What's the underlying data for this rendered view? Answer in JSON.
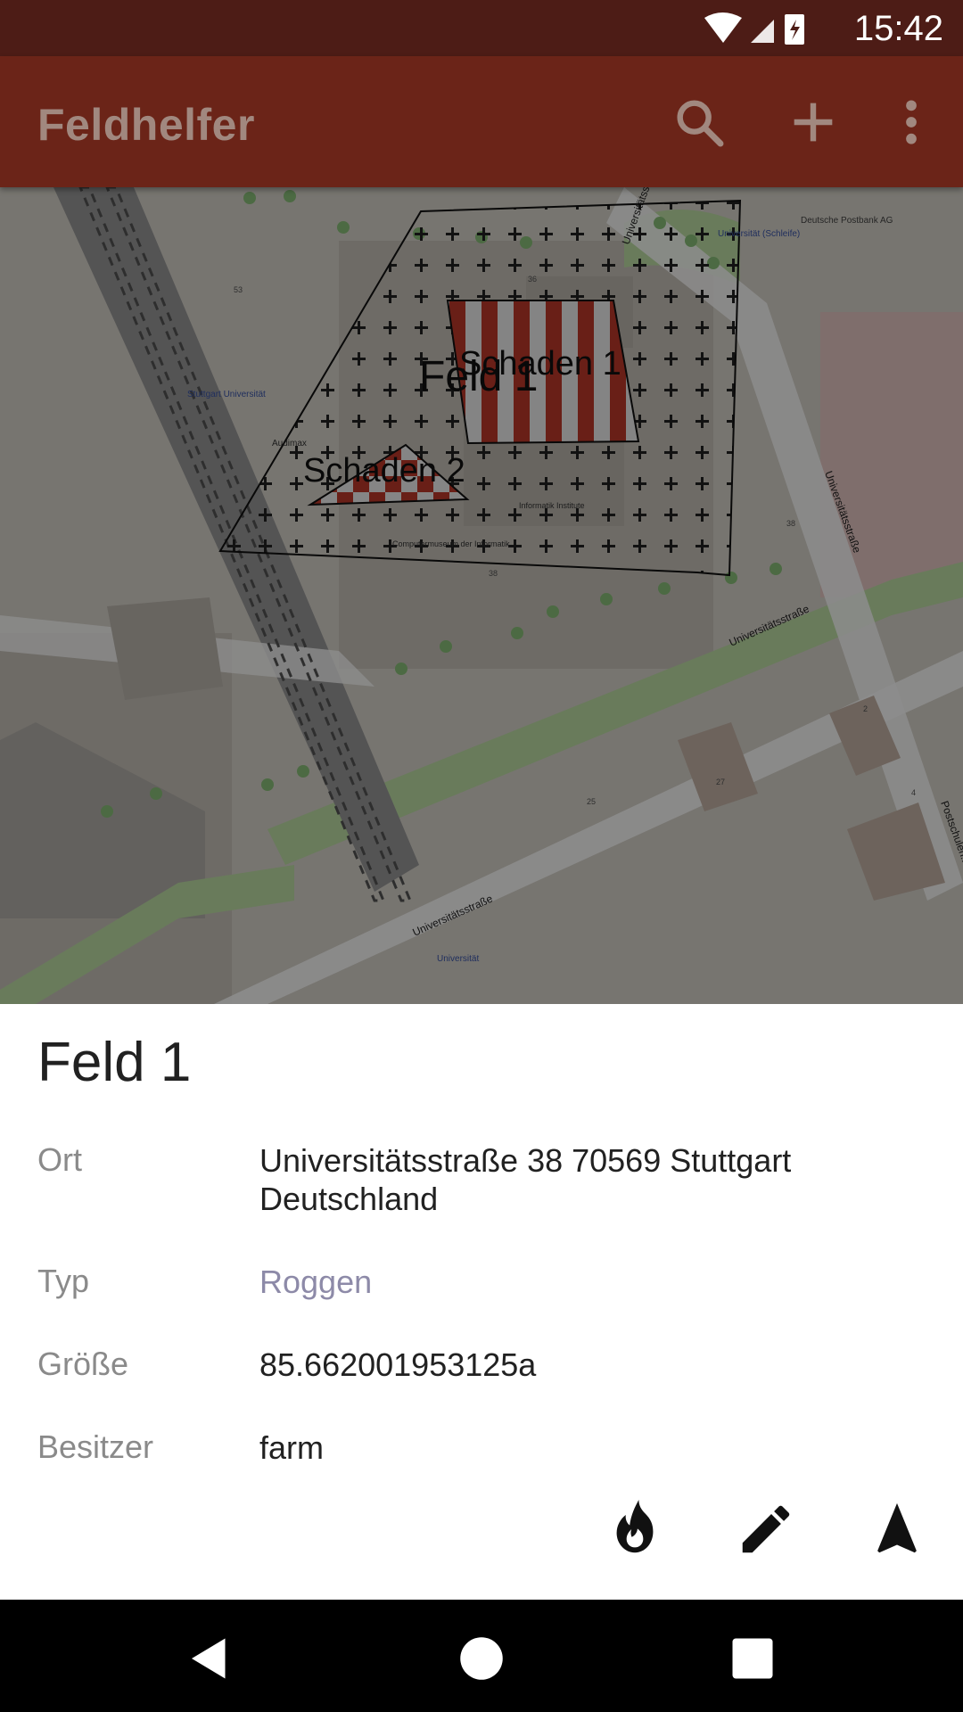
{
  "status_bar": {
    "time": "15:42"
  },
  "app_bar": {
    "title": "Feldhelfer",
    "icons": [
      "search-icon",
      "add-icon",
      "more-vert-icon"
    ]
  },
  "map": {
    "field_label": "Feld 1",
    "damage_labels": [
      "Schaden 1",
      "Schaden 2"
    ],
    "street_labels": [
      "Universitätsstraße",
      "Universitätsstraße",
      "Universitätsstraße",
      "Universitätsstraße",
      "Postschulen..."
    ],
    "poi_labels": [
      "Deutsche Postbank AG",
      "Universität (Schleife)",
      "Stuttgart Universität",
      "Audimax",
      "Computermuseum der Informatik",
      "Informatik Institute",
      "Universität"
    ],
    "house_numbers": [
      "53",
      "36",
      "38",
      "38",
      "2",
      "27",
      "25",
      "4"
    ]
  },
  "detail": {
    "title": "Feld 1",
    "rows": [
      {
        "label": "Ort",
        "value": " Universitätsstraße 38 70569 Stuttgart Deutschland"
      },
      {
        "label": "Typ",
        "value": "Roggen"
      },
      {
        "label": "Größe",
        "value": "85.662001953125a"
      },
      {
        "label": "Besitzer",
        "value": "farm"
      }
    ],
    "actions": [
      "fire-icon",
      "edit-icon",
      "navigate-icon"
    ]
  },
  "colors": {
    "status_bar": "#4d1c16",
    "app_bar": "#6b2418",
    "title_text": "#a1887f",
    "link_text": "#8d8aa8",
    "damage_red": "#c0392b"
  }
}
